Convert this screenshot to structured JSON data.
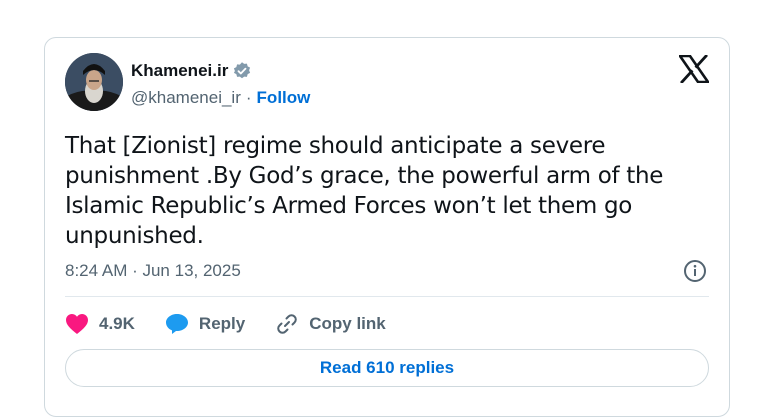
{
  "author": {
    "display_name": "Khamenei.ir",
    "handle": "@khamenei_ir",
    "separator": "·",
    "follow_label": "Follow",
    "verified_color": "#829aab"
  },
  "icons": {
    "platform_logo": "x-logo-icon",
    "verified": "verified-badge-icon",
    "info": "info-icon",
    "like": "heart-icon",
    "reply": "reply-bubble-icon",
    "copy_link": "link-icon"
  },
  "tweet": {
    "text": "That [Zionist] regime should anticipate a severe punishment .By God’s grace, the powerful arm of the Islamic Republic’s Armed Forces won’t let them go unpunished.",
    "timestamp": "8:24 AM · Jun 13, 2025"
  },
  "actions": {
    "like_count": "4.9K",
    "reply_label": "Reply",
    "copy_link_label": "Copy link"
  },
  "read_replies_label": "Read 610 replies",
  "colors": {
    "accent": "#006fd6",
    "heart": "#f91880",
    "reply_bubble": "#1d9bf0",
    "muted": "#536471"
  }
}
